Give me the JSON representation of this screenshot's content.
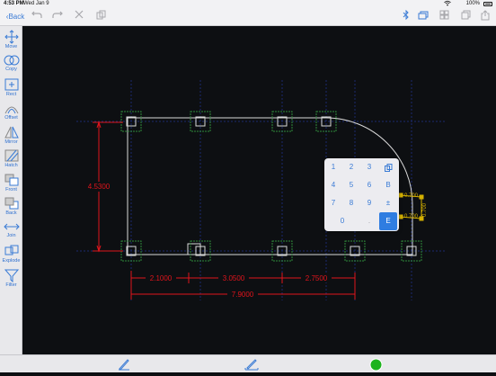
{
  "status": {
    "time": "4:53 PM",
    "date": "Wed Jan 9",
    "battery": "100%"
  },
  "toolbar": {
    "back_label": "Back"
  },
  "sidebar": {
    "items": [
      {
        "label": "Move",
        "icon": "move-icon"
      },
      {
        "label": "Copy",
        "icon": "copy-icon"
      },
      {
        "label": "Rect",
        "icon": "rect-icon"
      },
      {
        "label": "Offset",
        "icon": "offset-icon"
      },
      {
        "label": "Mirror",
        "icon": "mirror-icon"
      },
      {
        "label": "Hatch",
        "icon": "hatch-icon"
      },
      {
        "label": "Front",
        "icon": "front-icon"
      },
      {
        "label": "Back",
        "icon": "back-icon"
      },
      {
        "label": "Join",
        "icon": "join-icon"
      },
      {
        "label": "Explode",
        "icon": "explode-icon"
      },
      {
        "label": "Filter",
        "icon": "filter-icon"
      }
    ]
  },
  "drawing": {
    "dim_vertical": "4.5300",
    "dim_seg1": "2.1000",
    "dim_seg2": "3.0500",
    "dim_seg3": "2.7500",
    "dim_total": "7.9000",
    "arc_dim_a": "0.700",
    "arc_dim_b": "0.700",
    "arc_dim_c": "0.700"
  },
  "keypad": {
    "keys": [
      "1",
      "2",
      "3",
      "copy",
      "4",
      "5",
      "6",
      "B",
      "7",
      "8",
      "9",
      "±",
      "0",
      ".",
      "E"
    ]
  },
  "colors": {
    "accent": "#3a7bd5",
    "dimension": "#e0141c",
    "column": "#2e8b3a",
    "status_dot": "#1db31d"
  }
}
